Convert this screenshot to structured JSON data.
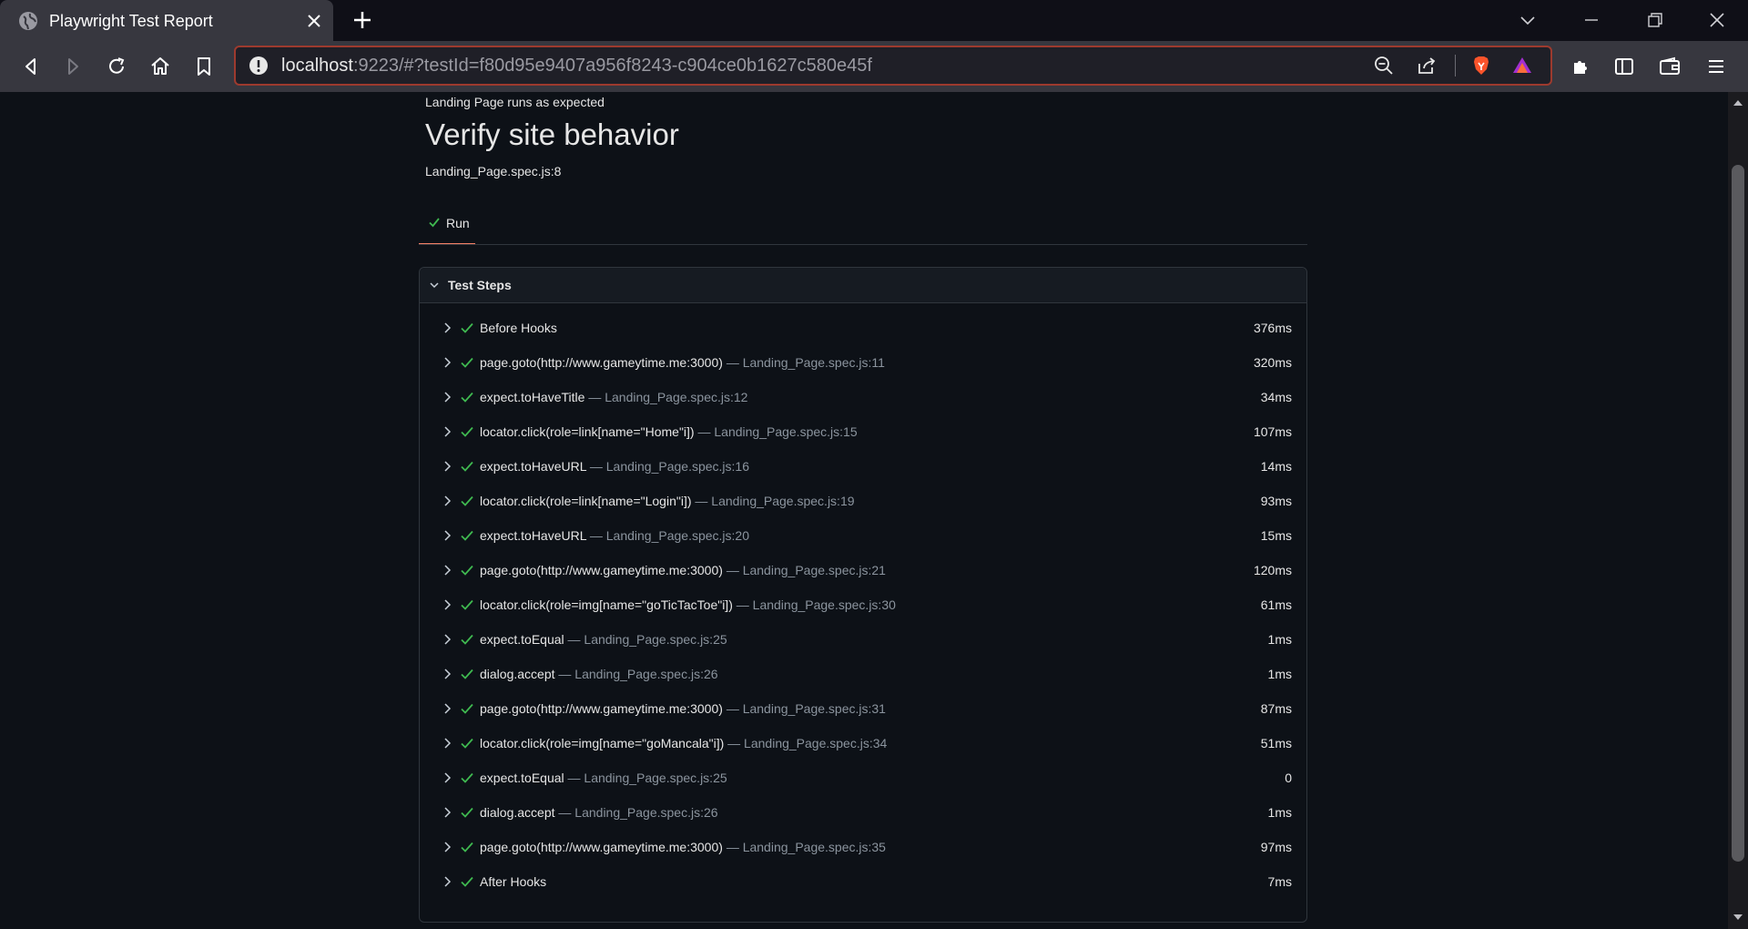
{
  "browser": {
    "tab_title": "Playwright Test Report",
    "url_host": "localhost",
    "url_rest": ":9223/#?testId=f80d95e9407a956f8243-c904ce0b1627c580e45f"
  },
  "report": {
    "path": "Landing Page runs as expected",
    "title": "Verify site behavior",
    "location": "Landing_Page.spec.js:8",
    "run_tab_label": "Run",
    "steps_header": "Test Steps",
    "steps": [
      {
        "title": "Before Hooks",
        "location": "",
        "duration": "376ms"
      },
      {
        "title": "page.goto(http://www.gameytime.me:3000)",
        "location": "— Landing_Page.spec.js:11",
        "duration": "320ms"
      },
      {
        "title": "expect.toHaveTitle",
        "location": "— Landing_Page.spec.js:12",
        "duration": "34ms"
      },
      {
        "title": "locator.click(role=link[name=\"Home\"i])",
        "location": "— Landing_Page.spec.js:15",
        "duration": "107ms"
      },
      {
        "title": "expect.toHaveURL",
        "location": "— Landing_Page.spec.js:16",
        "duration": "14ms"
      },
      {
        "title": "locator.click(role=link[name=\"Login\"i])",
        "location": "— Landing_Page.spec.js:19",
        "duration": "93ms"
      },
      {
        "title": "expect.toHaveURL",
        "location": "— Landing_Page.spec.js:20",
        "duration": "15ms"
      },
      {
        "title": "page.goto(http://www.gameytime.me:3000)",
        "location": "— Landing_Page.spec.js:21",
        "duration": "120ms"
      },
      {
        "title": "locator.click(role=img[name=\"goTicTacToe\"i])",
        "location": "— Landing_Page.spec.js:30",
        "duration": "61ms"
      },
      {
        "title": "expect.toEqual",
        "location": "— Landing_Page.spec.js:25",
        "duration": "1ms"
      },
      {
        "title": "dialog.accept",
        "location": "— Landing_Page.spec.js:26",
        "duration": "1ms"
      },
      {
        "title": "page.goto(http://www.gameytime.me:3000)",
        "location": "— Landing_Page.spec.js:31",
        "duration": "87ms"
      },
      {
        "title": "locator.click(role=img[name=\"goMancala\"i])",
        "location": "— Landing_Page.spec.js:34",
        "duration": "51ms"
      },
      {
        "title": "expect.toEqual",
        "location": "— Landing_Page.spec.js:25",
        "duration": "0"
      },
      {
        "title": "dialog.accept",
        "location": "— Landing_Page.spec.js:26",
        "duration": "1ms"
      },
      {
        "title": "page.goto(http://www.gameytime.me:3000)",
        "location": "— Landing_Page.spec.js:35",
        "duration": "97ms"
      },
      {
        "title": "After Hooks",
        "location": "",
        "duration": "7ms"
      }
    ]
  },
  "colors": {
    "pass_check": "#3fb950",
    "active_tab_underline": "#f78166",
    "page_background": "#0d1117"
  }
}
